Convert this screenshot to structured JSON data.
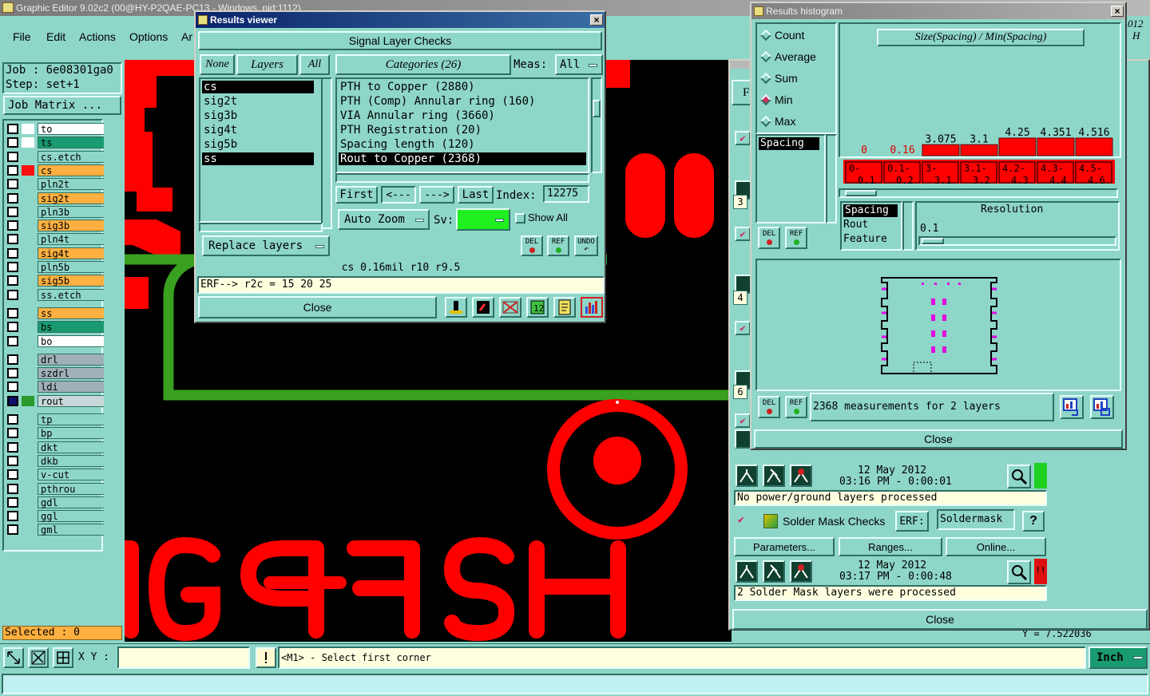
{
  "main": {
    "title": "Graphic Editor 9.02c2 (00@HY-P2QAE-PC13 - Windows, pid:1112)",
    "menu": [
      "File",
      "Edit",
      "Actions",
      "Options",
      "Ar"
    ],
    "job": "Job : 6e08301ga0",
    "step": "Step: set+1",
    "job_matrix": "Job Matrix ...",
    "right_fragment": "012",
    "right_fragment2": "H",
    "selected": "Selected : 0",
    "xy_label": "X Y :",
    "prompt": "<M1> - Select first corner",
    "units": "Inch",
    "coord_fragment": "Y = 7.522036",
    "layers": [
      {
        "name": "to",
        "color": "#ffffff",
        "row": "#ffffff",
        "sel": false
      },
      {
        "name": "ts",
        "color": "#ffffff",
        "row": "#1a9a70",
        "sel": false
      },
      {
        "name": "cs.etch",
        "color": "",
        "row": "#8ed6c8",
        "sel": false
      },
      {
        "name": "cs",
        "color": "#ff1010",
        "row": "#ffb040",
        "sel": false
      },
      {
        "name": "pln2t",
        "color": "",
        "row": "#8ed6c8",
        "sel": false
      },
      {
        "name": "sig2t",
        "color": "",
        "row": "#ffb040",
        "sel": false
      },
      {
        "name": "pln3b",
        "color": "",
        "row": "#8ed6c8",
        "sel": false
      },
      {
        "name": "sig3b",
        "color": "",
        "row": "#ffb040",
        "sel": false
      },
      {
        "name": "pln4t",
        "color": "",
        "row": "#8ed6c8",
        "sel": false
      },
      {
        "name": "sig4t",
        "color": "",
        "row": "#ffb040",
        "sel": false
      },
      {
        "name": "pln5b",
        "color": "",
        "row": "#8ed6c8",
        "sel": false
      },
      {
        "name": "sig5b",
        "color": "",
        "row": "#ffb040",
        "sel": false
      },
      {
        "name": "ss.etch",
        "color": "",
        "row": "#8ed6c8",
        "sel": false
      },
      {
        "name": "ss",
        "color": "",
        "row": "#ffb040",
        "sel": false
      },
      {
        "name": "bs",
        "color": "",
        "row": "#1a9a70",
        "sel": false
      },
      {
        "name": "bo",
        "color": "",
        "row": "#ffffff",
        "sel": false
      },
      {
        "name": "drl",
        "color": "",
        "row": "#a0b0b8",
        "sel": false
      },
      {
        "name": "szdrl",
        "color": "",
        "row": "#a0b0b8",
        "sel": false
      },
      {
        "name": "ldi",
        "color": "",
        "row": "#a0b0b8",
        "sel": false
      },
      {
        "name": "rout",
        "color": "#2a9a2a",
        "row": "#c8d8d8",
        "sel": true
      },
      {
        "name": "tp",
        "color": "",
        "row": "#8ed6c8",
        "sel": false
      },
      {
        "name": "bp",
        "color": "",
        "row": "#8ed6c8",
        "sel": false
      },
      {
        "name": "dkt",
        "color": "",
        "row": "#8ed6c8",
        "sel": false
      },
      {
        "name": "dkb",
        "color": "",
        "row": "#8ed6c8",
        "sel": false
      },
      {
        "name": "v-cut",
        "color": "",
        "row": "#8ed6c8",
        "sel": false
      },
      {
        "name": "pthrou",
        "color": "",
        "row": "#8ed6c8",
        "sel": false
      },
      {
        "name": "gdl",
        "color": "",
        "row": "#8ed6c8",
        "sel": false
      },
      {
        "name": "ggl",
        "color": "",
        "row": "#8ed6c8",
        "sel": false
      },
      {
        "name": "gml",
        "color": "",
        "row": "#8ed6c8",
        "sel": false
      }
    ],
    "canvas_text": "HSFP-GE"
  },
  "viewer": {
    "title": "Results viewer",
    "header": "Signal Layer Checks",
    "none_btn": "None",
    "layers_label": "Layers",
    "all_btn": "All",
    "categories_label": "Categories (26)",
    "meas_label": "Meas:",
    "meas_value": "All",
    "layers": [
      "cs",
      "sig2t",
      "sig3b",
      "sig4t",
      "sig5b",
      "ss"
    ],
    "categories": [
      "PTH to Copper (2880)",
      "PTH (Comp) Annular ring (160)",
      "VIA Annular ring (3660)",
      "PTH Registration (20)",
      "Spacing length (120)",
      "Rout to Copper (2368)"
    ],
    "first": "First",
    "prev": "<---",
    "next": "--->",
    "last": "Last",
    "index_label": "Index:",
    "index_value": "12275",
    "auto_zoom": "Auto Zoom",
    "sv_label": "Sv:",
    "show_all": "Show All",
    "replace_layers": "Replace layers",
    "del": "DEL",
    "ref": "REF",
    "undo": "UNDO",
    "status": "cs 0.16mil  r10  r9.5",
    "erf": "ERF--> r2c = 15 20 25",
    "close": "Close"
  },
  "histogram": {
    "title": "Results histogram",
    "options": [
      "Count",
      "Average",
      "Sum",
      "Min",
      "Max"
    ],
    "selected_option": "Min",
    "chart_title": "Size(Spacing) / Min(Spacing)",
    "left_list": [
      "Spacing"
    ],
    "del": "DEL",
    "ref": "REF",
    "measure_list": [
      "Spacing",
      "Rout",
      "Feature"
    ],
    "resolution_label": "Resolution",
    "resolution_value": "0.1",
    "summary": "2368 measurements for 2 layers",
    "close": "Close"
  },
  "chart_data": {
    "type": "bar",
    "title": "Size(Spacing) / Min(Spacing)",
    "categories": [
      "0-0.1",
      "0.1-0.2",
      "3-3.1",
      "3.1-3.2",
      "4.2-4.3",
      "4.3-4.4",
      "4.5-4.6"
    ],
    "values": [
      0,
      0.16,
      3.075,
      3.1,
      4.25,
      4.351,
      4.516
    ],
    "value_labels": [
      "0",
      "0.16",
      "3.075",
      "3.1",
      "4.25",
      "4.351",
      "4.516"
    ],
    "bar_fraction": [
      0,
      0,
      0.55,
      0.55,
      0.88,
      0.88,
      0.88
    ]
  },
  "checks": {
    "rows_numbers": [
      "3",
      "4",
      "6"
    ],
    "date1": "12 May 2012",
    "time1": "03:16 PM - 0:00:01",
    "msg1": "No power/ground layers processed",
    "title2": "Solder Mask Checks",
    "erf_label": "ERF:",
    "erf_value": "Soldermask",
    "help": "?",
    "parameters": "Parameters...",
    "ranges": "Ranges...",
    "online": "Online...",
    "date2": "12 May 2012",
    "time2": "03:17 PM - 0:00:48",
    "msg2": "2 Solder Mask layers were processed",
    "close": "Close",
    "fragment_f": "F"
  },
  "colors": {
    "teal": "#8ed6c8",
    "copper": "#ff0000",
    "rout": "#3aa020",
    "canvas": "#000000"
  }
}
